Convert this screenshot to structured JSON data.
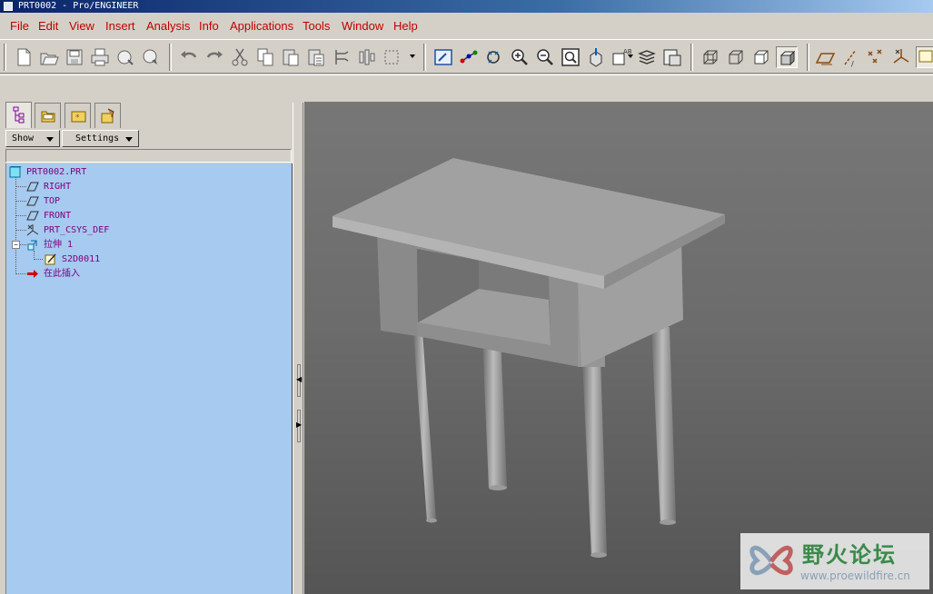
{
  "window": {
    "title": "PRT0002 - Pro/ENGINEER"
  },
  "menu": [
    "File",
    "Edit",
    "View",
    "Insert",
    "Analysis",
    "Info",
    "Applications",
    "Tools",
    "Window",
    "Help"
  ],
  "toolbar": {
    "icons": [
      "new-icon",
      "open-icon",
      "save-icon",
      "print-icon",
      "send-mail-icon",
      "send-link-icon",
      "undo-icon",
      "redo-icon",
      "cut-icon",
      "copy-icon",
      "paste-icon",
      "paste-special-icon",
      "regenerate-icon",
      "regen-manager-icon",
      "select-box-icon",
      "repaint-icon",
      "spin-center-icon",
      "orient-mode-icon",
      "zoom-in-icon",
      "zoom-out-icon",
      "refit-icon",
      "reorient-icon",
      "saved-views-icon",
      "layers-icon",
      "view-manager-icon",
      "wireframe-icon",
      "hidden-line-icon",
      "no-hidden-icon",
      "shading-icon",
      "datum-planes-icon",
      "datum-axes-icon",
      "datum-points-icon",
      "csys-icon",
      "sketch-icon"
    ],
    "pressed": "shading-icon"
  },
  "navigator": {
    "tabs": [
      "model-tree-tab-icon",
      "folder-browser-tab-icon",
      "favorites-tab-icon",
      "connections-tab-icon"
    ],
    "show_label": "Show",
    "settings_label": "Settings",
    "tree": [
      {
        "label": "PRT0002.PRT",
        "icon": "part-icon",
        "level": 0
      },
      {
        "label": "RIGHT",
        "icon": "datum-plane-icon",
        "level": 1
      },
      {
        "label": "TOP",
        "icon": "datum-plane-icon",
        "level": 1
      },
      {
        "label": "FRONT",
        "icon": "datum-plane-icon",
        "level": 1
      },
      {
        "label": "PRT_CSYS_DEF",
        "icon": "coordinate-system-icon",
        "level": 1
      },
      {
        "label": "拉伸 1",
        "icon": "extrude-icon",
        "level": 1
      },
      {
        "label": "S2D0011",
        "icon": "sketch-icon",
        "level": 2
      },
      {
        "label": "在此插入",
        "icon": "insert-here-arrow-icon",
        "level": 1
      }
    ]
  },
  "watermark": {
    "name": "野火论坛",
    "url": "www.proewildfire.cn"
  },
  "colors": {
    "tree_bg": "#a6caf0",
    "tree_text": "#800080",
    "menu_text": "#c00000",
    "model_gray": "#9a9a9a"
  }
}
